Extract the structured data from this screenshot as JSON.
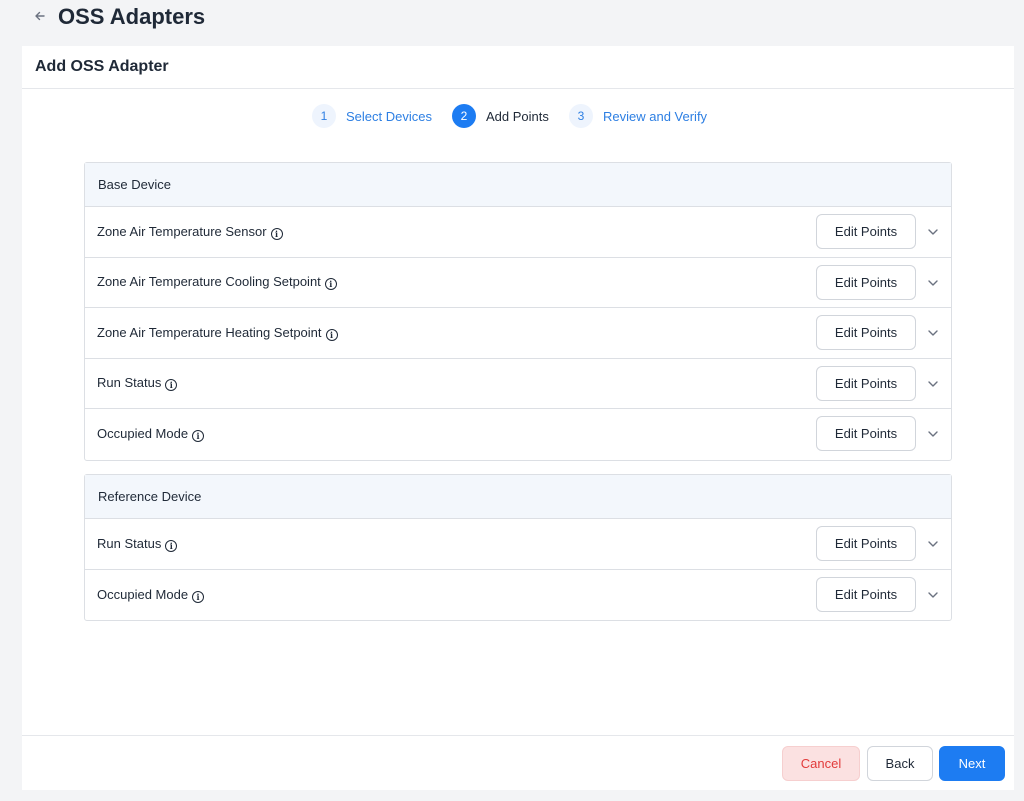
{
  "header": {
    "back_icon": "back-arrow-icon",
    "title": "OSS Adapters"
  },
  "card": {
    "title": "Add OSS Adapter"
  },
  "stepper": {
    "steps": [
      {
        "number": "1",
        "label": "Select Devices",
        "state": "inactive"
      },
      {
        "number": "2",
        "label": "Add Points",
        "state": "active"
      },
      {
        "number": "3",
        "label": "Review and Verify",
        "state": "inactive"
      }
    ]
  },
  "base_device": {
    "title": "Base Device",
    "rows": [
      {
        "label": "Zone Air Temperature Sensor",
        "button": "Edit Points"
      },
      {
        "label": "Zone Air Temperature Cooling Setpoint",
        "button": "Edit Points"
      },
      {
        "label": "Zone Air Temperature Heating Setpoint",
        "button": "Edit Points"
      },
      {
        "label": "Run Status",
        "button": "Edit Points"
      },
      {
        "label": "Occupied Mode",
        "button": "Edit Points"
      }
    ]
  },
  "reference_device": {
    "title": "Reference Device",
    "rows": [
      {
        "label": "Run Status",
        "button": "Edit Points"
      },
      {
        "label": "Occupied Mode",
        "button": "Edit Points"
      }
    ]
  },
  "footer": {
    "cancel_label": "Cancel",
    "back_label": "Back",
    "next_label": "Next"
  },
  "colors": {
    "accent": "#1d7cf2",
    "cancel_bg": "#fbe1e1",
    "cancel_text": "#e23b3b",
    "group_header_bg": "#f3f7fc"
  }
}
